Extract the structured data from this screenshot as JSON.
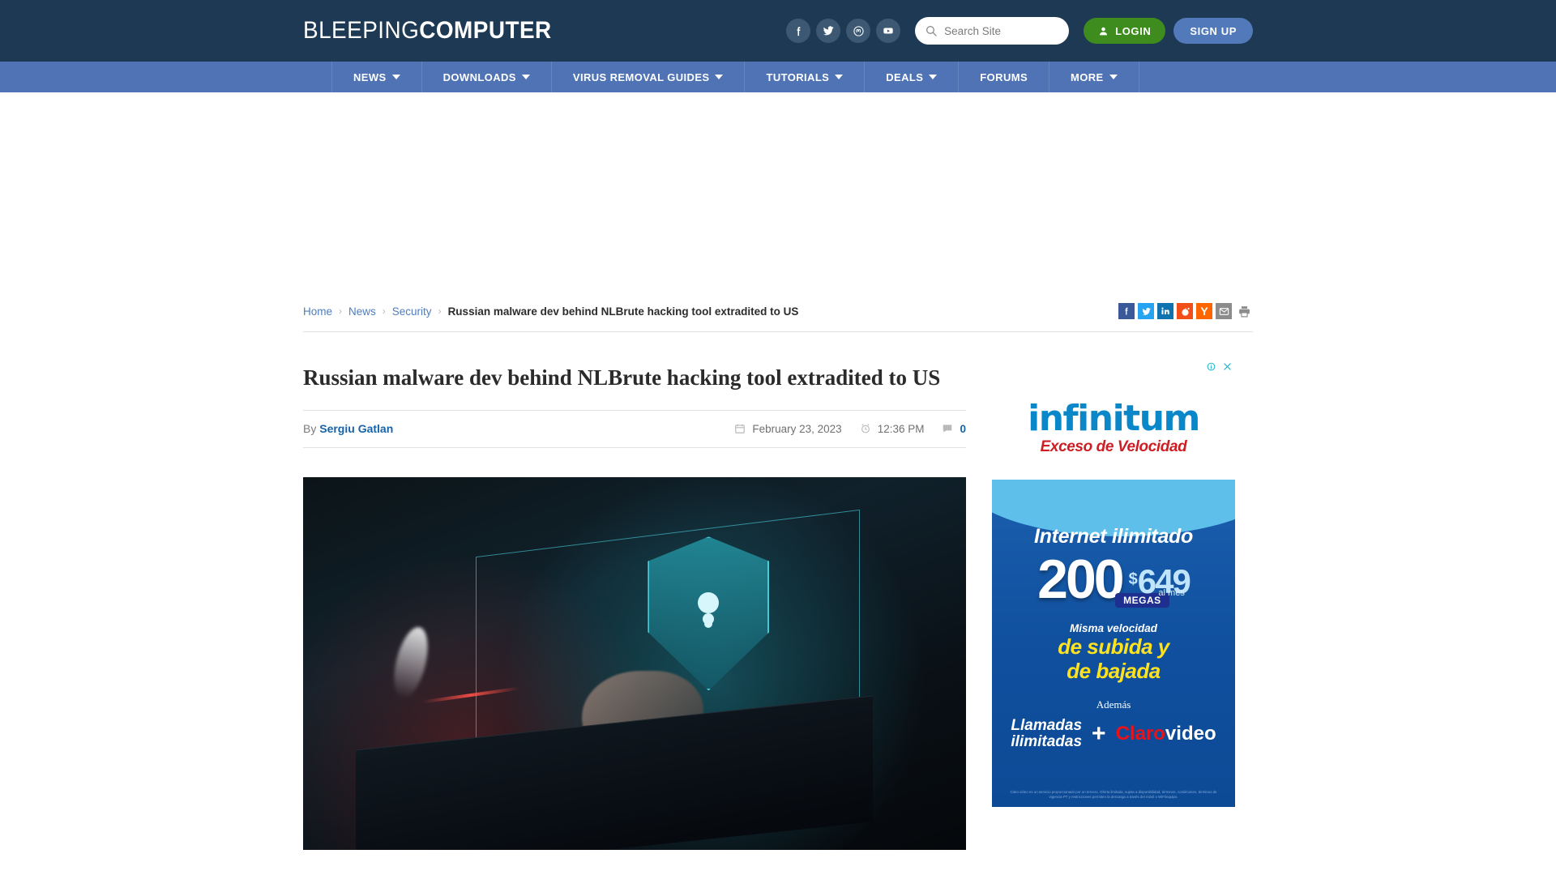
{
  "header": {
    "logo_light": "BLEEPING",
    "logo_bold": "COMPUTER",
    "social": [
      {
        "name": "facebook-icon",
        "label": "Facebook"
      },
      {
        "name": "twitter-icon",
        "label": "Twitter"
      },
      {
        "name": "mastodon-icon",
        "label": "Mastodon"
      },
      {
        "name": "youtube-icon",
        "label": "YouTube"
      }
    ],
    "search": {
      "placeholder": "Search Site",
      "value": ""
    },
    "login_label": "LOGIN",
    "signup_label": "SIGN UP",
    "bg_color": "#1e3953"
  },
  "nav": {
    "bg_color": "#4f73b5",
    "items": [
      {
        "label": "NEWS",
        "has_caret": true
      },
      {
        "label": "DOWNLOADS",
        "has_caret": true
      },
      {
        "label": "VIRUS REMOVAL GUIDES",
        "has_caret": true
      },
      {
        "label": "TUTORIALS",
        "has_caret": true
      },
      {
        "label": "DEALS",
        "has_caret": true
      },
      {
        "label": "FORUMS",
        "has_caret": false
      },
      {
        "label": "MORE",
        "has_caret": true
      }
    ]
  },
  "breadcrumb": {
    "items": [
      {
        "label": "Home",
        "link": true
      },
      {
        "label": "News",
        "link": true
      },
      {
        "label": "Security",
        "link": true
      }
    ],
    "separator": "›",
    "current": "Russian malware dev behind NLBrute hacking tool extradited to US"
  },
  "share": [
    {
      "name": "share-facebook-icon",
      "label": "f",
      "color": "#3b5998"
    },
    {
      "name": "share-twitter-icon",
      "label": "",
      "color": "#26a4f2"
    },
    {
      "name": "share-linkedin-icon",
      "label": "in",
      "color": "#0f73b0"
    },
    {
      "name": "share-reddit-icon",
      "label": "",
      "color": "#f24f18"
    },
    {
      "name": "share-hackernews-icon",
      "label": "Y",
      "color": "#ff6600"
    },
    {
      "name": "share-email-icon",
      "label": "",
      "color": "#8c8c8c"
    },
    {
      "name": "share-print-icon",
      "label": "",
      "color": "#8c8c8c"
    }
  ],
  "article": {
    "title": "Russian malware dev behind NLBrute hacking tool extradited to US",
    "by_label": "By",
    "author": "Sergiu Gatlan",
    "date": "February 23, 2023",
    "time": "12:36 PM",
    "comment_count": "0",
    "image_alt": "Hands typing on a laptop keyboard with a glowing cyan digital security shield hologram"
  },
  "sidebar": {
    "ad_choices_label": "AdChoices",
    "ad_close_label": "Close",
    "ad1": {
      "brand": "infinitum",
      "tagline": "Exceso de Velocidad"
    },
    "ad2": {
      "headline": "Internet ilimitado",
      "speed": "200",
      "speed_unit": "MEGAS",
      "currency": "$",
      "price": "649",
      "period": "al mes",
      "misma": "Misma velocidad",
      "line1": "de subida y",
      "line2": "de bajada",
      "ademas": "Además",
      "llamadas1": "Llamadas",
      "llamadas2": "ilimitadas",
      "plus": "+",
      "partner_red": "Claro",
      "partner_white": "video",
      "legal": "Claro video es un servicio proporcionado por un tercero. Oferta limitada, sujeta a disponibilidad, términos, condiciones, términos de vigencia PT y restricciones permiten la descarga a través del móvil o WiFi/equipo."
    }
  }
}
